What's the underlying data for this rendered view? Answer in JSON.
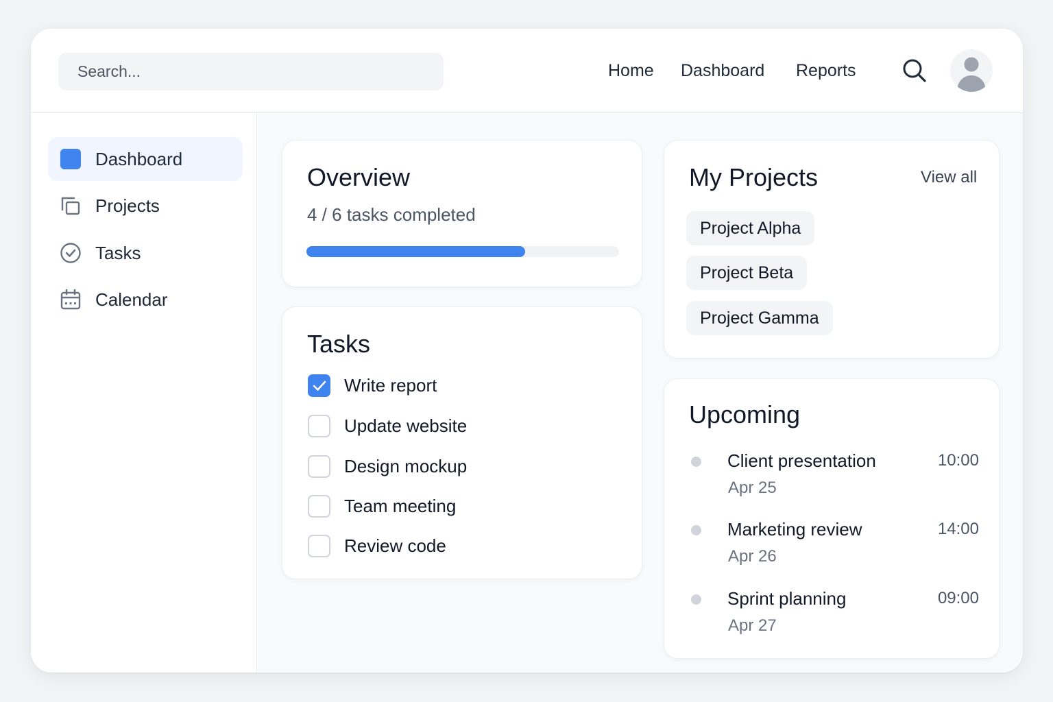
{
  "header": {
    "search_placeholder": "Search...",
    "nav": [
      "Home",
      "Dashboard",
      "Reports"
    ],
    "search_icon": "search-icon",
    "avatar_icon": "user-avatar-icon"
  },
  "sidebar": {
    "items": [
      {
        "label": "Dashboard",
        "icon": "dashboard-icon",
        "active": true
      },
      {
        "label": "Projects",
        "icon": "projects-icon",
        "active": false
      },
      {
        "label": "Tasks",
        "icon": "tasks-check-icon",
        "active": false
      },
      {
        "label": "Calendar",
        "icon": "calendar-icon",
        "active": false
      }
    ]
  },
  "overview": {
    "title": "Overview",
    "progress_text": "4 / 6 tasks completed",
    "progress_fraction": 0.7
  },
  "tasks": {
    "title": "Tasks",
    "items": [
      {
        "label": "Write report",
        "checked": true
      },
      {
        "label": "Update website",
        "checked": false
      },
      {
        "label": "Design mockup",
        "checked": false
      },
      {
        "label": "Team meeting",
        "checked": false
      },
      {
        "label": "Review code",
        "checked": false
      }
    ]
  },
  "projects": {
    "title": "My Projects",
    "view_all": "View all",
    "items": [
      "Project Alpha",
      "Project Beta",
      "Project Gamma"
    ]
  },
  "upcoming": {
    "title": "Upcoming",
    "events": [
      {
        "title": "Client presentation",
        "date": "Apr 25",
        "time": "10:00"
      },
      {
        "title": "Marketing review",
        "date": "Apr 26",
        "time": "14:00"
      },
      {
        "title": "Sprint planning",
        "date": "Apr 27",
        "time": "09:00"
      }
    ]
  },
  "colors": {
    "accent": "#3f83ee",
    "background": "#f3f4f6",
    "border": "#e5e7eb"
  }
}
